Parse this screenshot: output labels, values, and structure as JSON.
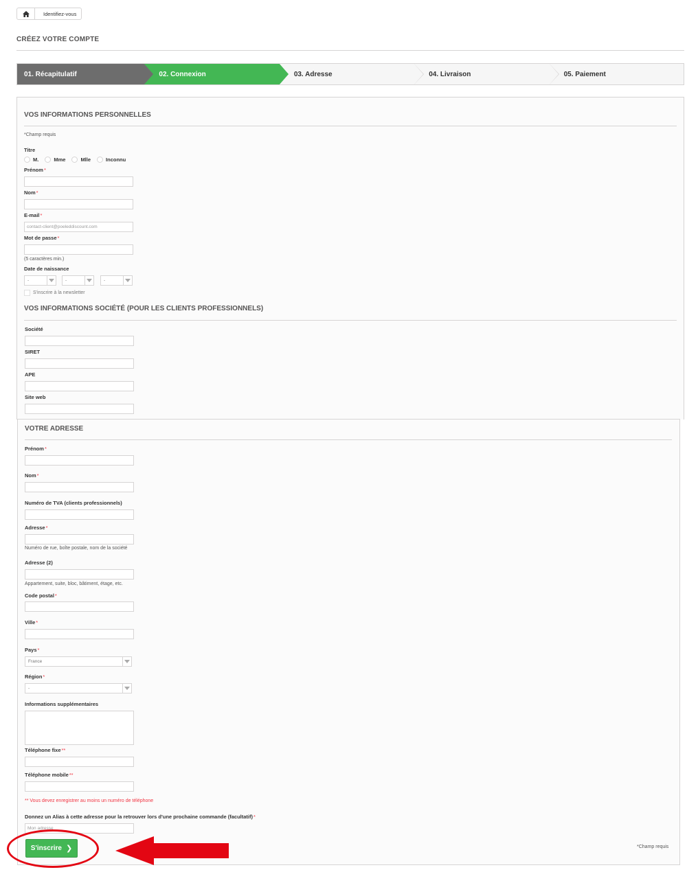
{
  "breadcrumb": {
    "home_icon": "home-icon",
    "current": "Identifiez-vous"
  },
  "page_heading": "CRÉEZ VOTRE COMPTE",
  "steps": [
    {
      "label": "01. Récapitulatif",
      "state": "done"
    },
    {
      "label": "02. Connexion",
      "state": "current"
    },
    {
      "label": "03. Adresse",
      "state": "todo"
    },
    {
      "label": "04. Livraison",
      "state": "todo"
    },
    {
      "label": "05. Paiement",
      "state": "todo"
    }
  ],
  "personal": {
    "title": "VOS INFORMATIONS PERSONNELLES",
    "required_note": "*Champ requis",
    "titre_label": "Titre",
    "titre_options": [
      "M.",
      "Mme",
      "Mlle",
      "Inconnu"
    ],
    "prenom_label": "Prénom",
    "nom_label": "Nom",
    "email_label": "E-mail",
    "email_value": "contact-client@poeleddiscount.com",
    "password_label": "Mot de passe",
    "password_hint": "(5 caractères min.)",
    "birth_label": "Date de naissance",
    "birth_day": "-",
    "birth_month": "-",
    "birth_year": "-",
    "newsletter_label": "S'inscrire à la newsletter"
  },
  "company": {
    "title": "VOS INFORMATIONS SOCIÉTÉ (POUR LES CLIENTS PROFESSIONNELS)",
    "societe_label": "Société",
    "siret_label": "SIRET",
    "ape_label": "APE",
    "site_label": "Site web"
  },
  "address": {
    "title": "VOTRE ADRESSE",
    "prenom_label": "Prénom",
    "nom_label": "Nom",
    "tva_label": "Numéro de TVA (clients professionnels)",
    "adresse_label": "Adresse",
    "adresse_hint": "Numéro de rue, boîte postale, nom de la société",
    "adresse2_label": "Adresse (2)",
    "adresse2_hint": "Appartement, suite, bloc, bâtiment, étage, etc.",
    "cp_label": "Code postal",
    "ville_label": "Ville",
    "pays_label": "Pays",
    "pays_value": "France",
    "region_label": "Région",
    "region_value": "-",
    "info_label": "Informations supplémentaires",
    "tel_fixe_label": "Téléphone fixe",
    "tel_mobile_label": "Téléphone mobile",
    "tel_error": "** Vous devez enregistrer au moins un numéro de téléphone",
    "alias_label": "Donnez un Alias à cette adresse pour la retrouver lors d'une prochaine commande (facultatif)",
    "alias_value": "Mon adresse",
    "submit_label": "S'inscrire",
    "required_note": "*Champ requis"
  },
  "colors": {
    "green": "#43b754",
    "grey_step": "#6d6d6d",
    "annotation_red": "#e30613"
  }
}
